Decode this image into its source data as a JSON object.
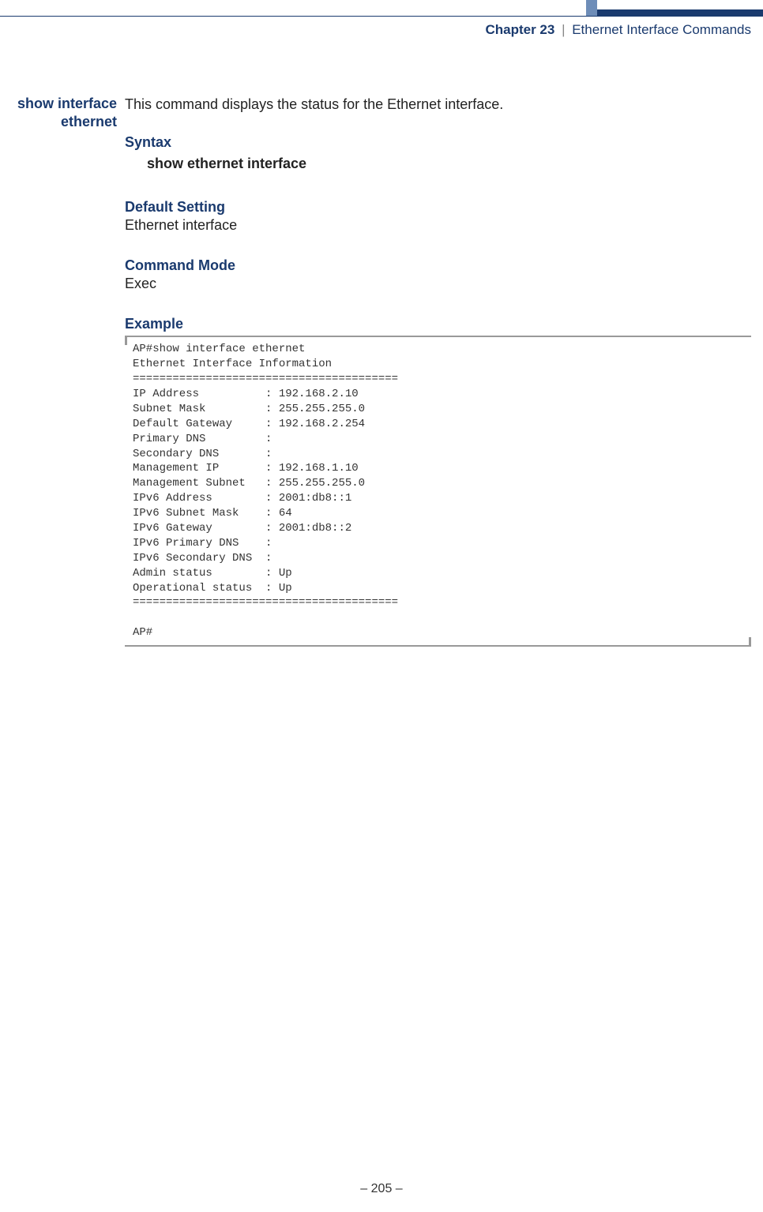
{
  "header": {
    "chapter_prefix": "Chapter 23",
    "separator": "|",
    "chapter_title": "Ethernet Interface Commands"
  },
  "command": {
    "name_line1": "show interface",
    "name_line2": "ethernet",
    "description": "This command displays the status for the Ethernet interface."
  },
  "sections": {
    "syntax_h": "Syntax",
    "syntax_cmd": "show ethernet interface",
    "default_h": "Default Setting",
    "default_v": "Ethernet interface",
    "mode_h": "Command Mode",
    "mode_v": "Exec",
    "example_h": "Example"
  },
  "code": "AP#show interface ethernet\nEthernet Interface Information\n========================================\nIP Address          : 192.168.2.10\nSubnet Mask         : 255.255.255.0\nDefault Gateway     : 192.168.2.254\nPrimary DNS         :\nSecondary DNS       :\nManagement IP       : 192.168.1.10\nManagement Subnet   : 255.255.255.0\nIPv6 Address        : 2001:db8::1\nIPv6 Subnet Mask    : 64\nIPv6 Gateway        : 2001:db8::2\nIPv6 Primary DNS    :\nIPv6 Secondary DNS  :\nAdmin status        : Up\nOperational status  : Up\n========================================\n\nAP#",
  "page_number": "–  205  –"
}
